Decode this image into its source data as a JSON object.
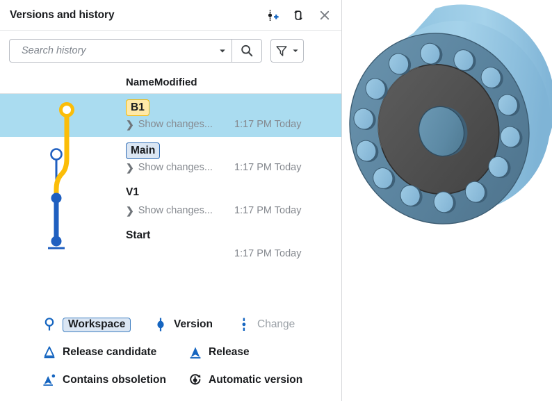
{
  "window": {
    "title": "Versions and history",
    "actions": [
      {
        "name": "add-version-icon",
        "label": "Add version"
      },
      {
        "name": "compare-versions-icon",
        "label": "Compare"
      },
      {
        "name": "close-icon",
        "label": "Close"
      }
    ]
  },
  "search": {
    "placeholder": "Search history",
    "value": "",
    "dropdown_label": "Search options",
    "search_button_label": "Search",
    "filter_button_label": "Filter"
  },
  "table": {
    "columns": [
      "Name",
      "Modified"
    ],
    "rows": [
      {
        "name": "B1",
        "badge": "branch",
        "changes_label": "Show changes...",
        "modified": "1:17 PM Today",
        "selected": true,
        "node": "workspace"
      },
      {
        "name": "Main",
        "badge": "main",
        "changes_label": "Show changes...",
        "modified": "1:17 PM Today",
        "selected": false,
        "node": "workspace"
      },
      {
        "name": "V1",
        "badge": "none",
        "changes_label": "Show changes...",
        "modified": "1:17 PM Today",
        "selected": false,
        "node": "version"
      },
      {
        "name": "Start",
        "badge": "none",
        "changes_label": "",
        "modified": "1:17 PM Today",
        "selected": false,
        "node": "version"
      }
    ]
  },
  "legend": [
    {
      "icon": "workspace-icon",
      "label": "Workspace",
      "selected": true,
      "muted": false
    },
    {
      "icon": "version-icon",
      "label": "Version",
      "selected": false,
      "muted": false
    },
    {
      "icon": "change-icon",
      "label": "Change",
      "selected": false,
      "muted": true
    },
    {
      "icon": "release-candidate-icon",
      "label": "Release candidate",
      "selected": false,
      "muted": false
    },
    {
      "icon": "release-icon",
      "label": "Release",
      "selected": false,
      "muted": false
    },
    {
      "icon": "contains-obsoletion-icon",
      "label": "Contains obsoletion",
      "selected": false,
      "muted": false
    },
    {
      "icon": "automatic-version-icon",
      "label": "Automatic version",
      "selected": false,
      "muted": false
    }
  ],
  "colors": {
    "selection_row": "#aadcf0",
    "branch_yellow": "#fbbd08",
    "branch_badge_bg": "#ffe9a8",
    "version_blue": "#1f5fc0",
    "main_badge_bg": "#dbe6f3",
    "accent_blue": "#1565c0",
    "muted_text": "#85898f",
    "model_flange_light": "#9ac9e3",
    "model_flange_mid": "#5d89a5",
    "model_face_dark": "#4f4f4f",
    "model_hub": "#5d89a5"
  },
  "viewer": {
    "model_name": "flange-3d-model"
  }
}
